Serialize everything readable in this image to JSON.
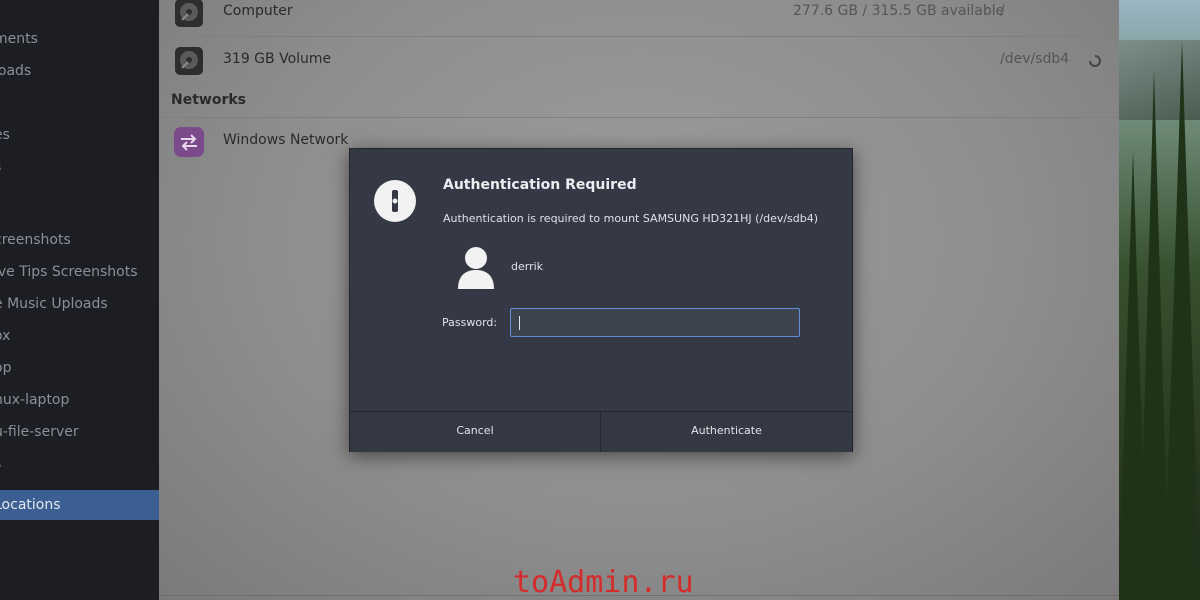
{
  "sidebar": {
    "items": [
      {
        "label": "ments"
      },
      {
        "label": "loads"
      },
      {
        "label": "es"
      },
      {
        "label": "s"
      },
      {
        "label": "creenshots"
      },
      {
        "label": "ive Tips Screenshots"
      },
      {
        "label": "e Music Uploads"
      },
      {
        "label": "ox"
      },
      {
        "label": "op"
      },
      {
        "label": "nux-laptop"
      },
      {
        "label": "u-file-server"
      },
      {
        "label": "s"
      },
      {
        "label": "Locations"
      }
    ],
    "active_color": "#3b5f92"
  },
  "devices": [
    {
      "name": "Computer",
      "available": "277.6 GB / 315.5 GB available",
      "path": "/",
      "icon": "hard-disk-icon"
    },
    {
      "name": "319 GB Volume",
      "path": "/dev/sdb4",
      "icon": "hard-disk-icon",
      "status": "spinner-icon"
    }
  ],
  "networks": {
    "title": "Networks",
    "items": [
      {
        "name": "Windows Network",
        "icon": "network-icon"
      }
    ]
  },
  "dialog": {
    "title": "Authentication Required",
    "message": "Authentication is required to mount SAMSUNG HD321HJ (/dev/sdb4)",
    "user": "derrik",
    "password_label": "Password:",
    "password_value": "",
    "cancel_label": "Cancel",
    "authenticate_label": "Authenticate",
    "icon": "lock-icon"
  },
  "watermark": "toAdmin.ru",
  "colors": {
    "dialog_bg": "#353945",
    "focus": "#5f8fd6",
    "watermark": "#d42b2b"
  }
}
